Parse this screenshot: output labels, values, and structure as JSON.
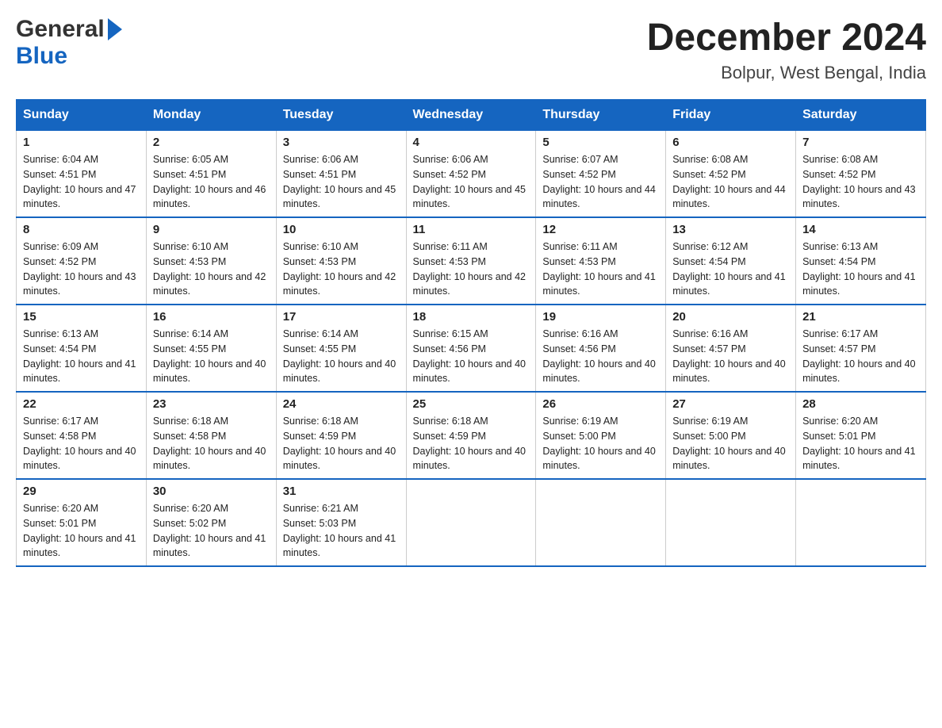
{
  "logo": {
    "general": "General",
    "blue": "Blue",
    "arrow": "▶"
  },
  "title": "December 2024",
  "subtitle": "Bolpur, West Bengal, India",
  "days_header": [
    "Sunday",
    "Monday",
    "Tuesday",
    "Wednesday",
    "Thursday",
    "Friday",
    "Saturday"
  ],
  "weeks": [
    [
      {
        "day": "1",
        "sunrise": "6:04 AM",
        "sunset": "4:51 PM",
        "daylight": "10 hours and 47 minutes."
      },
      {
        "day": "2",
        "sunrise": "6:05 AM",
        "sunset": "4:51 PM",
        "daylight": "10 hours and 46 minutes."
      },
      {
        "day": "3",
        "sunrise": "6:06 AM",
        "sunset": "4:51 PM",
        "daylight": "10 hours and 45 minutes."
      },
      {
        "day": "4",
        "sunrise": "6:06 AM",
        "sunset": "4:52 PM",
        "daylight": "10 hours and 45 minutes."
      },
      {
        "day": "5",
        "sunrise": "6:07 AM",
        "sunset": "4:52 PM",
        "daylight": "10 hours and 44 minutes."
      },
      {
        "day": "6",
        "sunrise": "6:08 AM",
        "sunset": "4:52 PM",
        "daylight": "10 hours and 44 minutes."
      },
      {
        "day": "7",
        "sunrise": "6:08 AM",
        "sunset": "4:52 PM",
        "daylight": "10 hours and 43 minutes."
      }
    ],
    [
      {
        "day": "8",
        "sunrise": "6:09 AM",
        "sunset": "4:52 PM",
        "daylight": "10 hours and 43 minutes."
      },
      {
        "day": "9",
        "sunrise": "6:10 AM",
        "sunset": "4:53 PM",
        "daylight": "10 hours and 42 minutes."
      },
      {
        "day": "10",
        "sunrise": "6:10 AM",
        "sunset": "4:53 PM",
        "daylight": "10 hours and 42 minutes."
      },
      {
        "day": "11",
        "sunrise": "6:11 AM",
        "sunset": "4:53 PM",
        "daylight": "10 hours and 42 minutes."
      },
      {
        "day": "12",
        "sunrise": "6:11 AM",
        "sunset": "4:53 PM",
        "daylight": "10 hours and 41 minutes."
      },
      {
        "day": "13",
        "sunrise": "6:12 AM",
        "sunset": "4:54 PM",
        "daylight": "10 hours and 41 minutes."
      },
      {
        "day": "14",
        "sunrise": "6:13 AM",
        "sunset": "4:54 PM",
        "daylight": "10 hours and 41 minutes."
      }
    ],
    [
      {
        "day": "15",
        "sunrise": "6:13 AM",
        "sunset": "4:54 PM",
        "daylight": "10 hours and 41 minutes."
      },
      {
        "day": "16",
        "sunrise": "6:14 AM",
        "sunset": "4:55 PM",
        "daylight": "10 hours and 40 minutes."
      },
      {
        "day": "17",
        "sunrise": "6:14 AM",
        "sunset": "4:55 PM",
        "daylight": "10 hours and 40 minutes."
      },
      {
        "day": "18",
        "sunrise": "6:15 AM",
        "sunset": "4:56 PM",
        "daylight": "10 hours and 40 minutes."
      },
      {
        "day": "19",
        "sunrise": "6:16 AM",
        "sunset": "4:56 PM",
        "daylight": "10 hours and 40 minutes."
      },
      {
        "day": "20",
        "sunrise": "6:16 AM",
        "sunset": "4:57 PM",
        "daylight": "10 hours and 40 minutes."
      },
      {
        "day": "21",
        "sunrise": "6:17 AM",
        "sunset": "4:57 PM",
        "daylight": "10 hours and 40 minutes."
      }
    ],
    [
      {
        "day": "22",
        "sunrise": "6:17 AM",
        "sunset": "4:58 PM",
        "daylight": "10 hours and 40 minutes."
      },
      {
        "day": "23",
        "sunrise": "6:18 AM",
        "sunset": "4:58 PM",
        "daylight": "10 hours and 40 minutes."
      },
      {
        "day": "24",
        "sunrise": "6:18 AM",
        "sunset": "4:59 PM",
        "daylight": "10 hours and 40 minutes."
      },
      {
        "day": "25",
        "sunrise": "6:18 AM",
        "sunset": "4:59 PM",
        "daylight": "10 hours and 40 minutes."
      },
      {
        "day": "26",
        "sunrise": "6:19 AM",
        "sunset": "5:00 PM",
        "daylight": "10 hours and 40 minutes."
      },
      {
        "day": "27",
        "sunrise": "6:19 AM",
        "sunset": "5:00 PM",
        "daylight": "10 hours and 40 minutes."
      },
      {
        "day": "28",
        "sunrise": "6:20 AM",
        "sunset": "5:01 PM",
        "daylight": "10 hours and 41 minutes."
      }
    ],
    [
      {
        "day": "29",
        "sunrise": "6:20 AM",
        "sunset": "5:01 PM",
        "daylight": "10 hours and 41 minutes."
      },
      {
        "day": "30",
        "sunrise": "6:20 AM",
        "sunset": "5:02 PM",
        "daylight": "10 hours and 41 minutes."
      },
      {
        "day": "31",
        "sunrise": "6:21 AM",
        "sunset": "5:03 PM",
        "daylight": "10 hours and 41 minutes."
      },
      null,
      null,
      null,
      null
    ]
  ]
}
